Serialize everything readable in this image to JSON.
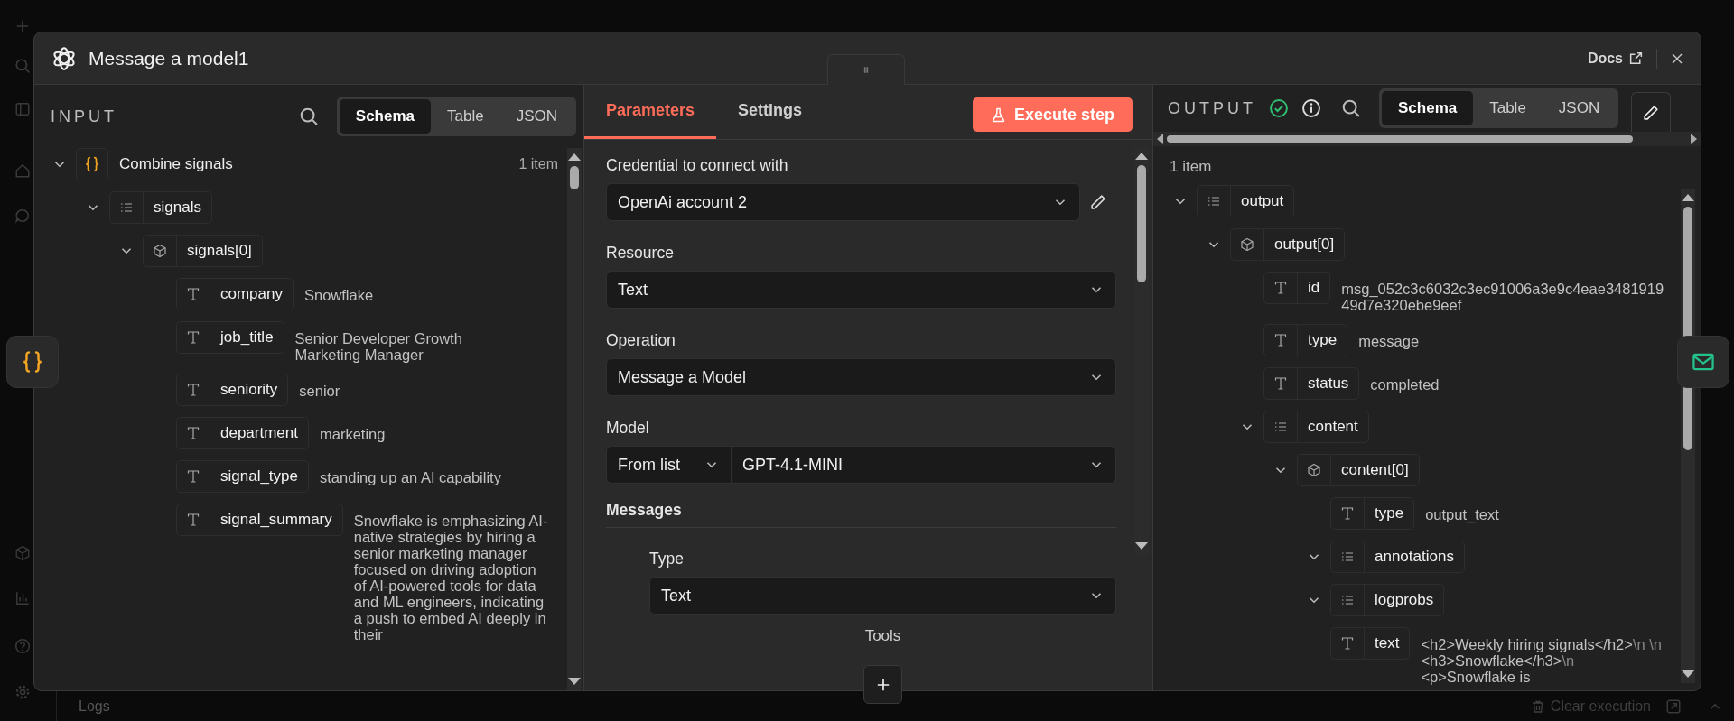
{
  "background": {
    "logs_label": "Logs",
    "clear_button": "Clear execution"
  },
  "window": {
    "title": "Message a model1",
    "docs_link": "Docs"
  },
  "input_panel": {
    "heading": "INPUT",
    "view_tabs": [
      {
        "label": "Schema",
        "selected": true
      },
      {
        "label": "Table",
        "selected": false
      },
      {
        "label": "JSON",
        "selected": false
      }
    ],
    "tree": [
      {
        "kind": "root",
        "label": "Combine signals",
        "count": "1 item",
        "expanded": true,
        "children": [
          {
            "kind": "array",
            "key": "signals",
            "expanded": true,
            "children": [
              {
                "kind": "object",
                "key": "signals[0]",
                "expanded": true,
                "children": [
                  {
                    "kind": "string",
                    "key": "company",
                    "value": "Snowflake"
                  },
                  {
                    "kind": "string",
                    "key": "job_title",
                    "value": "Senior Developer Growth Marketing Manager"
                  },
                  {
                    "kind": "string",
                    "key": "seniority",
                    "value": "senior"
                  },
                  {
                    "kind": "string",
                    "key": "department",
                    "value": "marketing"
                  },
                  {
                    "kind": "string",
                    "key": "signal_type",
                    "value": "standing up an AI capability"
                  },
                  {
                    "kind": "string",
                    "key": "signal_summary",
                    "value": "Snowflake is emphasizing AI-native strategies by hiring a senior marketing manager focused on driving adoption of AI-powered tools for data and ML engineers, indicating a push to embed AI deeply in their"
                  }
                ]
              }
            ]
          }
        ]
      }
    ]
  },
  "parameters_panel": {
    "tabs": [
      {
        "label": "Parameters",
        "selected": true
      },
      {
        "label": "Settings",
        "selected": false
      }
    ],
    "execute_button": "Execute step",
    "fields": [
      {
        "kind": "select",
        "label": "Credential to connect with",
        "value": "OpenAi account 2",
        "edit_icon": true
      },
      {
        "kind": "select",
        "label": "Resource",
        "value": "Text"
      },
      {
        "kind": "select",
        "label": "Operation",
        "value": "Message a Model"
      },
      {
        "kind": "split_select",
        "label": "Model",
        "mode": "From list",
        "value": "GPT-4.1-MINI"
      },
      {
        "kind": "section",
        "label": "Messages",
        "children": [
          {
            "kind": "select",
            "label": "Type",
            "value": "Text"
          }
        ]
      },
      {
        "kind": "collection",
        "label": "Tools"
      }
    ]
  },
  "output_panel": {
    "heading": "OUTPUT",
    "succeeded": true,
    "view_tabs": [
      {
        "label": "Schema",
        "selected": true
      },
      {
        "label": "Table",
        "selected": false
      },
      {
        "label": "JSON",
        "selected": false
      }
    ],
    "item_count": "1 item",
    "tree": [
      {
        "kind": "array",
        "key": "output",
        "expanded": true,
        "children": [
          {
            "kind": "object",
            "key": "output[0]",
            "expanded": true,
            "children": [
              {
                "kind": "string",
                "key": "id",
                "value": "msg_052c3c6032c3ec91006a3e9c4eae348191949d7e320ebe9eef"
              },
              {
                "kind": "string",
                "key": "type",
                "value": "message"
              },
              {
                "kind": "string",
                "key": "status",
                "value": "completed"
              },
              {
                "kind": "array",
                "key": "content",
                "expanded": true,
                "children": [
                  {
                    "kind": "object",
                    "key": "content[0]",
                    "expanded": true,
                    "children": [
                      {
                        "kind": "string",
                        "key": "type",
                        "value": "output_text"
                      },
                      {
                        "kind": "array",
                        "key": "annotations",
                        "expanded": true
                      },
                      {
                        "kind": "array",
                        "key": "logprobs",
                        "expanded": true
                      },
                      {
                        "kind": "string",
                        "key": "text",
                        "segments": [
                          {
                            "kind": "plain",
                            "text": "<h2>Weekly hiring signals</h2>"
                          },
                          {
                            "kind": "escape",
                            "text": "\\n"
                          },
                          {
                            "kind": "escape",
                            "text": " \\n"
                          },
                          {
                            "kind": "plain",
                            "text": " <h3>Snowflake</h3>"
                          },
                          {
                            "kind": "escape",
                            "text": "\\n"
                          },
                          {
                            "kind": "plain",
                            "text": " <p>Snowflake is"
                          }
                        ]
                      }
                    ]
                  }
                ]
              }
            ]
          }
        ]
      }
    ]
  }
}
